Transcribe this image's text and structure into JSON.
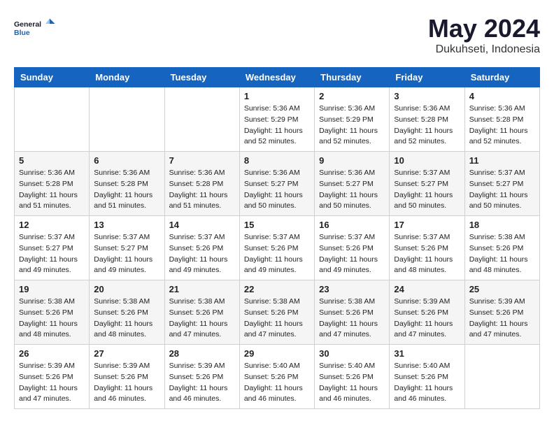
{
  "header": {
    "logo_line1": "General",
    "logo_line2": "Blue",
    "month": "May 2024",
    "location": "Dukuhseti, Indonesia"
  },
  "weekdays": [
    "Sunday",
    "Monday",
    "Tuesday",
    "Wednesday",
    "Thursday",
    "Friday",
    "Saturday"
  ],
  "weeks": [
    [
      {
        "day": "",
        "sunrise": "",
        "sunset": "",
        "daylight": ""
      },
      {
        "day": "",
        "sunrise": "",
        "sunset": "",
        "daylight": ""
      },
      {
        "day": "",
        "sunrise": "",
        "sunset": "",
        "daylight": ""
      },
      {
        "day": "1",
        "sunrise": "Sunrise: 5:36 AM",
        "sunset": "Sunset: 5:29 PM",
        "daylight": "Daylight: 11 hours and 52 minutes."
      },
      {
        "day": "2",
        "sunrise": "Sunrise: 5:36 AM",
        "sunset": "Sunset: 5:29 PM",
        "daylight": "Daylight: 11 hours and 52 minutes."
      },
      {
        "day": "3",
        "sunrise": "Sunrise: 5:36 AM",
        "sunset": "Sunset: 5:28 PM",
        "daylight": "Daylight: 11 hours and 52 minutes."
      },
      {
        "day": "4",
        "sunrise": "Sunrise: 5:36 AM",
        "sunset": "Sunset: 5:28 PM",
        "daylight": "Daylight: 11 hours and 52 minutes."
      }
    ],
    [
      {
        "day": "5",
        "sunrise": "Sunrise: 5:36 AM",
        "sunset": "Sunset: 5:28 PM",
        "daylight": "Daylight: 11 hours and 51 minutes."
      },
      {
        "day": "6",
        "sunrise": "Sunrise: 5:36 AM",
        "sunset": "Sunset: 5:28 PM",
        "daylight": "Daylight: 11 hours and 51 minutes."
      },
      {
        "day": "7",
        "sunrise": "Sunrise: 5:36 AM",
        "sunset": "Sunset: 5:28 PM",
        "daylight": "Daylight: 11 hours and 51 minutes."
      },
      {
        "day": "8",
        "sunrise": "Sunrise: 5:36 AM",
        "sunset": "Sunset: 5:27 PM",
        "daylight": "Daylight: 11 hours and 50 minutes."
      },
      {
        "day": "9",
        "sunrise": "Sunrise: 5:36 AM",
        "sunset": "Sunset: 5:27 PM",
        "daylight": "Daylight: 11 hours and 50 minutes."
      },
      {
        "day": "10",
        "sunrise": "Sunrise: 5:37 AM",
        "sunset": "Sunset: 5:27 PM",
        "daylight": "Daylight: 11 hours and 50 minutes."
      },
      {
        "day": "11",
        "sunrise": "Sunrise: 5:37 AM",
        "sunset": "Sunset: 5:27 PM",
        "daylight": "Daylight: 11 hours and 50 minutes."
      }
    ],
    [
      {
        "day": "12",
        "sunrise": "Sunrise: 5:37 AM",
        "sunset": "Sunset: 5:27 PM",
        "daylight": "Daylight: 11 hours and 49 minutes."
      },
      {
        "day": "13",
        "sunrise": "Sunrise: 5:37 AM",
        "sunset": "Sunset: 5:27 PM",
        "daylight": "Daylight: 11 hours and 49 minutes."
      },
      {
        "day": "14",
        "sunrise": "Sunrise: 5:37 AM",
        "sunset": "Sunset: 5:26 PM",
        "daylight": "Daylight: 11 hours and 49 minutes."
      },
      {
        "day": "15",
        "sunrise": "Sunrise: 5:37 AM",
        "sunset": "Sunset: 5:26 PM",
        "daylight": "Daylight: 11 hours and 49 minutes."
      },
      {
        "day": "16",
        "sunrise": "Sunrise: 5:37 AM",
        "sunset": "Sunset: 5:26 PM",
        "daylight": "Daylight: 11 hours and 49 minutes."
      },
      {
        "day": "17",
        "sunrise": "Sunrise: 5:37 AM",
        "sunset": "Sunset: 5:26 PM",
        "daylight": "Daylight: 11 hours and 48 minutes."
      },
      {
        "day": "18",
        "sunrise": "Sunrise: 5:38 AM",
        "sunset": "Sunset: 5:26 PM",
        "daylight": "Daylight: 11 hours and 48 minutes."
      }
    ],
    [
      {
        "day": "19",
        "sunrise": "Sunrise: 5:38 AM",
        "sunset": "Sunset: 5:26 PM",
        "daylight": "Daylight: 11 hours and 48 minutes."
      },
      {
        "day": "20",
        "sunrise": "Sunrise: 5:38 AM",
        "sunset": "Sunset: 5:26 PM",
        "daylight": "Daylight: 11 hours and 48 minutes."
      },
      {
        "day": "21",
        "sunrise": "Sunrise: 5:38 AM",
        "sunset": "Sunset: 5:26 PM",
        "daylight": "Daylight: 11 hours and 47 minutes."
      },
      {
        "day": "22",
        "sunrise": "Sunrise: 5:38 AM",
        "sunset": "Sunset: 5:26 PM",
        "daylight": "Daylight: 11 hours and 47 minutes."
      },
      {
        "day": "23",
        "sunrise": "Sunrise: 5:38 AM",
        "sunset": "Sunset: 5:26 PM",
        "daylight": "Daylight: 11 hours and 47 minutes."
      },
      {
        "day": "24",
        "sunrise": "Sunrise: 5:39 AM",
        "sunset": "Sunset: 5:26 PM",
        "daylight": "Daylight: 11 hours and 47 minutes."
      },
      {
        "day": "25",
        "sunrise": "Sunrise: 5:39 AM",
        "sunset": "Sunset: 5:26 PM",
        "daylight": "Daylight: 11 hours and 47 minutes."
      }
    ],
    [
      {
        "day": "26",
        "sunrise": "Sunrise: 5:39 AM",
        "sunset": "Sunset: 5:26 PM",
        "daylight": "Daylight: 11 hours and 47 minutes."
      },
      {
        "day": "27",
        "sunrise": "Sunrise: 5:39 AM",
        "sunset": "Sunset: 5:26 PM",
        "daylight": "Daylight: 11 hours and 46 minutes."
      },
      {
        "day": "28",
        "sunrise": "Sunrise: 5:39 AM",
        "sunset": "Sunset: 5:26 PM",
        "daylight": "Daylight: 11 hours and 46 minutes."
      },
      {
        "day": "29",
        "sunrise": "Sunrise: 5:40 AM",
        "sunset": "Sunset: 5:26 PM",
        "daylight": "Daylight: 11 hours and 46 minutes."
      },
      {
        "day": "30",
        "sunrise": "Sunrise: 5:40 AM",
        "sunset": "Sunset: 5:26 PM",
        "daylight": "Daylight: 11 hours and 46 minutes."
      },
      {
        "day": "31",
        "sunrise": "Sunrise: 5:40 AM",
        "sunset": "Sunset: 5:26 PM",
        "daylight": "Daylight: 11 hours and 46 minutes."
      },
      {
        "day": "",
        "sunrise": "",
        "sunset": "",
        "daylight": ""
      }
    ]
  ]
}
